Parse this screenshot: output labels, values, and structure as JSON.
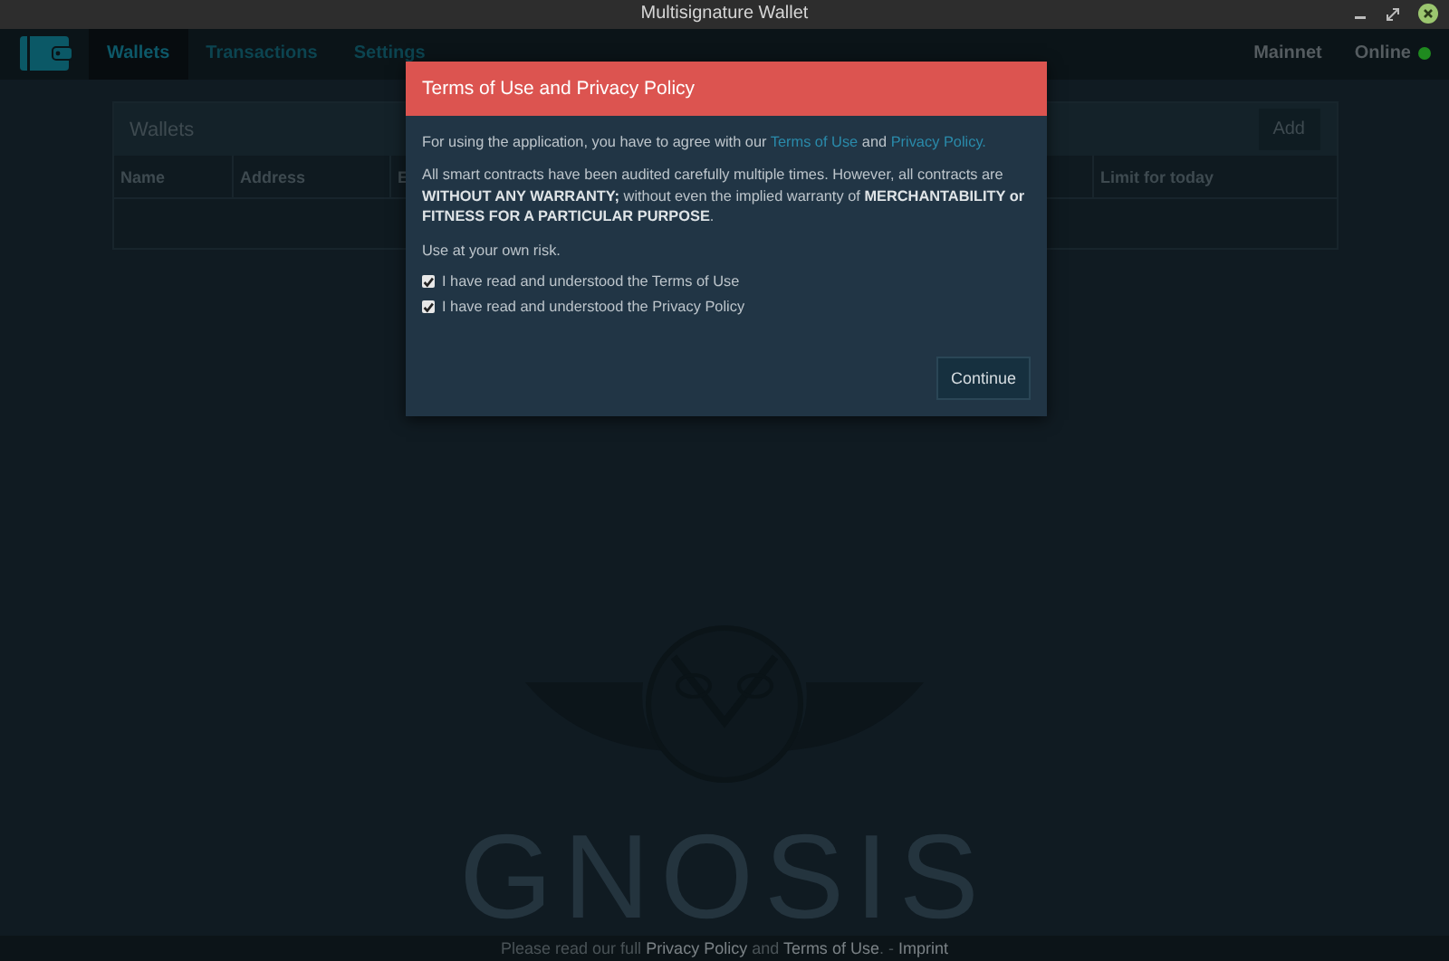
{
  "window": {
    "title": "Multisignature Wallet"
  },
  "nav": {
    "tabs": [
      {
        "label": "Wallets",
        "selected": true
      },
      {
        "label": "Transactions",
        "selected": false
      },
      {
        "label": "Settings",
        "selected": false
      }
    ],
    "network": "Mainnet",
    "status": {
      "label": "Online",
      "color": "#1f8a1f"
    }
  },
  "wallets_panel": {
    "title": "Wallets",
    "add_button": "Add",
    "columns": [
      "Name",
      "Address",
      "E",
      "Limit for today"
    ]
  },
  "logo_text": "GNOSIS",
  "footer": {
    "before": "Please read our full",
    "privacy_link": "Privacy Policy",
    "middle": "and",
    "terms_link": "Terms of Use",
    "after": ". -",
    "imprint_link": "Imprint"
  },
  "modal": {
    "title": "Terms of Use and Privacy Policy",
    "intro": "For using the application, you have to agree with our",
    "terms_link": "Terms of Use",
    "and": "and",
    "privacy_link": "Privacy Policy.",
    "warranty": "All smart contracts have been audited carefully multiple times. However, all contracts are **WITHOUT ANY WARRANTY;** without even the implied warranty of **MERCHANTABILITY or FITNESS FOR A PARTICULAR PURPOSE**.",
    "risk": "Use at your own risk.",
    "checkboxes": [
      {
        "label": "I have read and understood the Terms of Use",
        "checked": true
      },
      {
        "label": "I have read and understood the Privacy Policy",
        "checked": true
      }
    ],
    "continue_button": "Continue"
  }
}
